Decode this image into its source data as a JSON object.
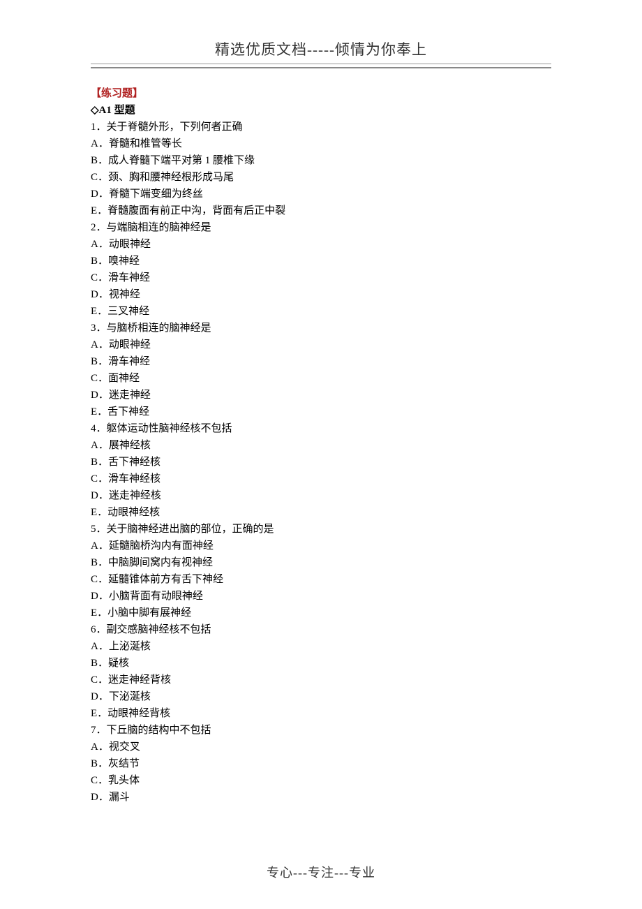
{
  "header": "精选优质文档-----倾情为你奉上",
  "section_title": "【练习题】",
  "sub_title": "◇A1 型题",
  "questions": [
    {
      "stem": "1．关于脊髓外形，下列何者正确",
      "options": [
        "A．脊髓和椎管等长",
        "B．成人脊髓下端平对第 1 腰椎下缘",
        "C．颈、胸和腰神经根形成马尾",
        "D．脊髓下端变细为终丝",
        "E．脊髓腹面有前正中沟，背面有后正中裂"
      ]
    },
    {
      "stem": "2．与端脑相连的脑神经是",
      "options": [
        "A．动眼神经",
        "B．嗅神经",
        "C．滑车神经",
        "D．视神经",
        "E．三叉神经"
      ]
    },
    {
      "stem": "3．与脑桥相连的脑神经是",
      "options": [
        "A．动眼神经",
        "B．滑车神经",
        "C．面神经",
        "D．迷走神经",
        "E．舌下神经"
      ]
    },
    {
      "stem": "4．躯体运动性脑神经核不包括",
      "options": [
        "A．展神经核",
        "B．舌下神经核",
        "C．滑车神经核",
        "D．迷走神经核",
        "E．动眼神经核"
      ]
    },
    {
      "stem": "5．关于脑神经进出脑的部位，正确的是",
      "options": [
        "A．延髓脑桥沟内有面神经",
        "B．中脑脚间窝内有视神经",
        "C．延髓锥体前方有舌下神经",
        "D．小脑背面有动眼神经",
        "E．小脑中脚有展神经"
      ]
    },
    {
      "stem": "6．副交感脑神经核不包括",
      "options": [
        "A．上泌涎核",
        "B．疑核",
        "C．迷走神经背核",
        "D．下泌涎核",
        "E．动眼神经背核"
      ]
    },
    {
      "stem": "7．下丘脑的结构中不包括",
      "options": [
        "A．视交叉",
        "B．灰结节",
        "C．乳头体",
        "D．漏斗"
      ]
    }
  ],
  "footer": "专心---专注---专业"
}
